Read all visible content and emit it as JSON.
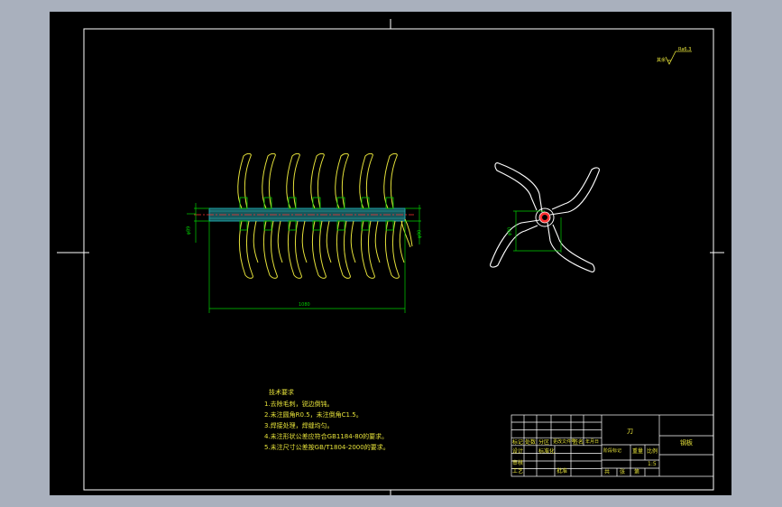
{
  "roughness": {
    "label": "其余",
    "value": "Ra6.3"
  },
  "technical_requirements": {
    "title": "技术要求",
    "notes": [
      "1.去除毛刺，锐边倒钝。",
      "2.未注圆角R0.5，未注倒角C1.5。",
      "3.焊接处理，焊缝均匀。",
      "4.未注形状公差应符合GB1184-80的要求。",
      "5.未注尺寸公差按GB/T1804-2000的要求。"
    ]
  },
  "dimensions": {
    "overall_length": "1080",
    "shaft_dia": "φ89",
    "right_dia": "φ90",
    "rotor_span": "φ90"
  },
  "title_block": {
    "part_name": "刀",
    "unit": "钢板",
    "labels": {
      "mark": "标记",
      "count": "处数",
      "zone": "分区",
      "change_doc": "更改文件号",
      "sign": "签名",
      "date": "年月日",
      "design": "设计",
      "review": "审核",
      "process": "工艺",
      "approve": "批准",
      "stage_mark": "阶段标记",
      "weight": "重量",
      "scale": "比例",
      "scale_value": "1:5",
      "sheets_total": "共",
      "sheet_unit": "张",
      "sheet_no": "第",
      "standardize": "标准化"
    }
  },
  "colors": {
    "background": "#a9b0bd",
    "sheet": "#000000",
    "frame": "#ffffff",
    "blade": "#e6e23a",
    "dimension": "#00d000",
    "shaft": "#1fa4a8",
    "centerline": "#ff3030"
  }
}
